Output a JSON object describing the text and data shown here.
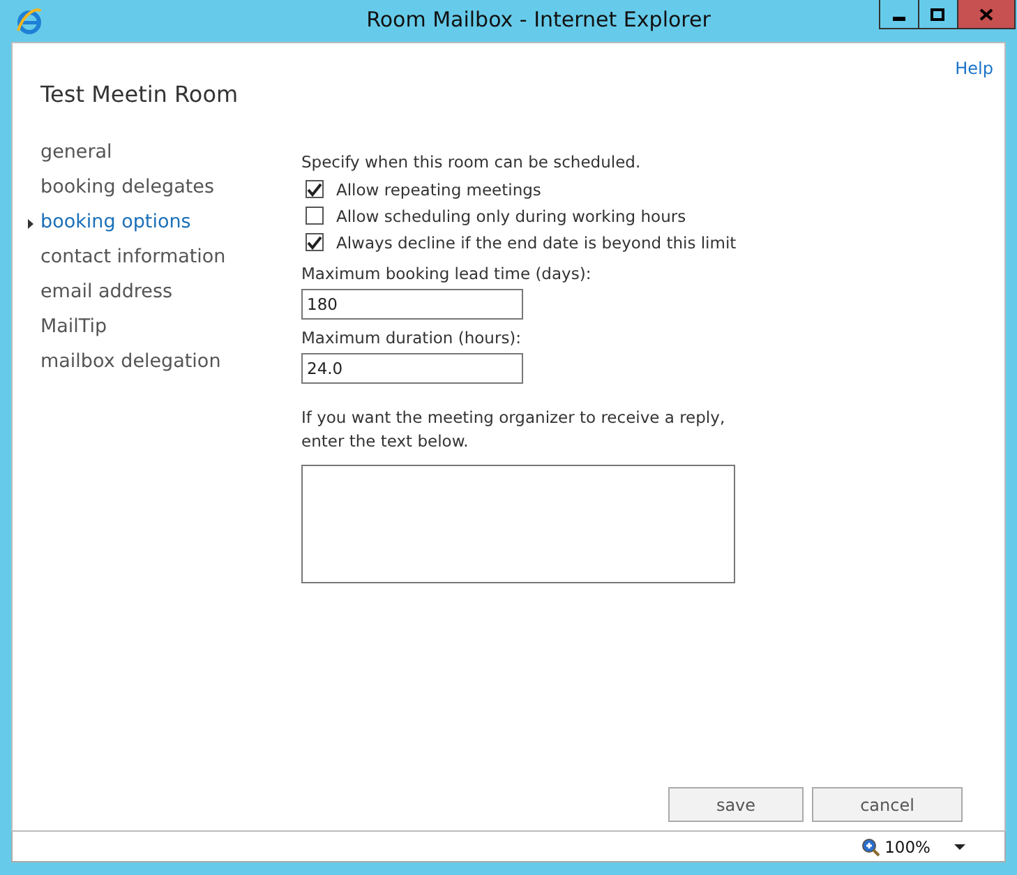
{
  "window": {
    "title": "Room Mailbox - Internet Explorer"
  },
  "help_link": "Help",
  "heading": "Test Meetin Room",
  "nav": [
    {
      "label": "general",
      "selected": false
    },
    {
      "label": "booking delegates",
      "selected": false
    },
    {
      "label": "booking options",
      "selected": true
    },
    {
      "label": "contact information",
      "selected": false
    },
    {
      "label": "email address",
      "selected": false
    },
    {
      "label": "MailTip",
      "selected": false
    },
    {
      "label": "mailbox delegation",
      "selected": false
    }
  ],
  "intro": "Specify when this room can be scheduled.",
  "checkboxes": [
    {
      "label": "Allow repeating meetings",
      "checked": true
    },
    {
      "label": "Allow scheduling only during working hours",
      "checked": false
    },
    {
      "label": "Always decline if the end date is beyond this limit",
      "checked": true
    }
  ],
  "fields": [
    {
      "label": "Maximum booking lead time (days):",
      "value": "180"
    },
    {
      "label": "Maximum duration (hours):",
      "value": "24.0"
    }
  ],
  "reply_prompt": "If you want the meeting organizer to receive a reply, enter the text below.",
  "buttons": [
    "save",
    "cancel"
  ],
  "status_bar": {
    "zoom": "100%"
  }
}
